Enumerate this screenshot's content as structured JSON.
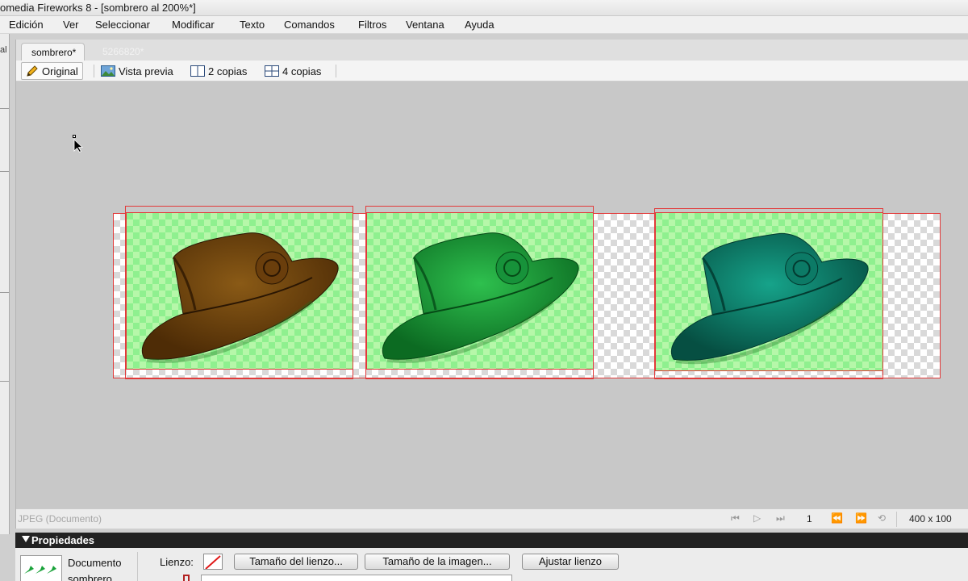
{
  "window": {
    "title": "omedia Fireworks 8 - [sombrero al 200%*]"
  },
  "menu": [
    "Edición",
    "Ver",
    "Seleccionar",
    "Modificar",
    "Texto",
    "Comandos",
    "Filtros",
    "Ventana",
    "Ayuda"
  ],
  "left_strip": {
    "fragment": "al"
  },
  "tabs": [
    {
      "label": "sombrero*",
      "active": true
    },
    {
      "label": "5266820*",
      "active": false
    }
  ],
  "view_modes": [
    {
      "label": "Original",
      "icon": "pencil-icon",
      "active": true
    },
    {
      "label": "Vista previa",
      "icon": "preview-image-icon",
      "active": false
    },
    {
      "label": "2 copias",
      "icon": "two-panes-icon",
      "active": false
    },
    {
      "label": "4 copias",
      "icon": "four-panes-icon",
      "active": false
    }
  ],
  "canvas": {
    "selection_color": "#e23a3a",
    "hats": [
      {
        "name": "hat-brown",
        "tint": "#7a4a10",
        "shade": "#4e2c06"
      },
      {
        "name": "hat-green",
        "tint": "#1aa23a",
        "shade": "#0c6b22"
      },
      {
        "name": "hat-teal",
        "tint": "#0e8a72",
        "shade": "#064f42"
      }
    ]
  },
  "status": {
    "doc_type": "JPEG (Documento)",
    "frame": "1",
    "size": "400 x 100"
  },
  "properties": {
    "title": "Propiedades",
    "doc_label": "Documento",
    "doc_name": "sombrero",
    "canvas_label": "Lienzo:",
    "buttons": {
      "canvas_size": "Tamaño del lienzo...",
      "image_size": "Tamaño de la imagen...",
      "fit_canvas": "Ajustar lienzo"
    }
  }
}
